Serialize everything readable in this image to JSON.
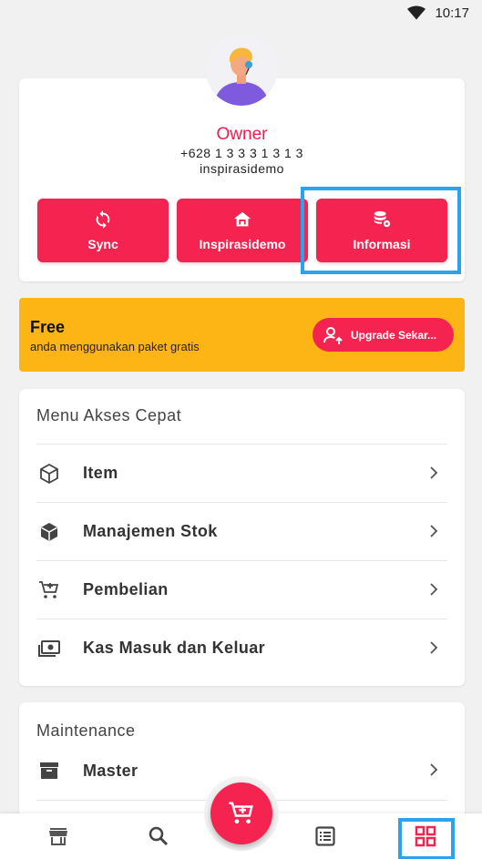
{
  "status_bar": {
    "time": "10:17"
  },
  "profile": {
    "name": "Owner",
    "phone": "+628 1 3 3 3 1 3 1 3",
    "store": "inspirasidemo"
  },
  "actions": [
    {
      "label": "Sync",
      "icon": "sync-icon"
    },
    {
      "label": "Inspirasidemo",
      "icon": "store-icon"
    },
    {
      "label": "Informasi",
      "icon": "database-settings-icon"
    }
  ],
  "plan": {
    "title": "Free",
    "description": "anda menggunakan paket gratis",
    "upgrade_label": "Upgrade Sekar..."
  },
  "quick_menu": {
    "title": "Menu Akses Cepat",
    "items": [
      {
        "label": "Item",
        "icon": "cube-icon"
      },
      {
        "label": "Manajemen Stok",
        "icon": "stock-icon"
      },
      {
        "label": "Pembelian",
        "icon": "cart-add-icon"
      },
      {
        "label": "Kas Masuk dan Keluar",
        "icon": "cash-icon"
      }
    ]
  },
  "maintenance": {
    "title": "Maintenance",
    "items": [
      {
        "label": "Master",
        "icon": "archive-icon"
      }
    ]
  },
  "bottom_nav": [
    "store-icon",
    "search-icon",
    "cart-icon",
    "list-icon",
    "grid-icon"
  ],
  "colors": {
    "accent": "#f42350",
    "name": "#ef1c4d",
    "banner": "#fdb515",
    "highlight": "#2aa3ef"
  }
}
